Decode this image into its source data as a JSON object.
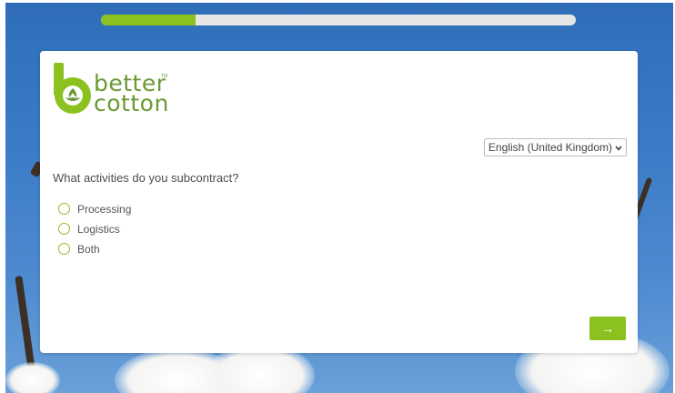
{
  "progress": {
    "fraction": 0.2,
    "fill_color": "#8cc21f",
    "track_color": "#e6e6e6"
  },
  "logo": {
    "line1": "better",
    "line2": "cotton",
    "trademark": "TM",
    "icon": "better-cotton-logo-icon"
  },
  "language": {
    "selected": "English (United Kingdom)",
    "icon": "chevron-down-icon"
  },
  "question": {
    "text": "What activities do you subcontract?"
  },
  "options": [
    {
      "label": "Processing"
    },
    {
      "label": "Logistics"
    },
    {
      "label": "Both"
    }
  ],
  "next_button": {
    "label": "→",
    "icon": "arrow-right-icon",
    "color": "#8cc21f"
  },
  "colors": {
    "accent": "#8cc21f",
    "brand_green": "#6a9a34",
    "sky": "#3a7bc6"
  }
}
